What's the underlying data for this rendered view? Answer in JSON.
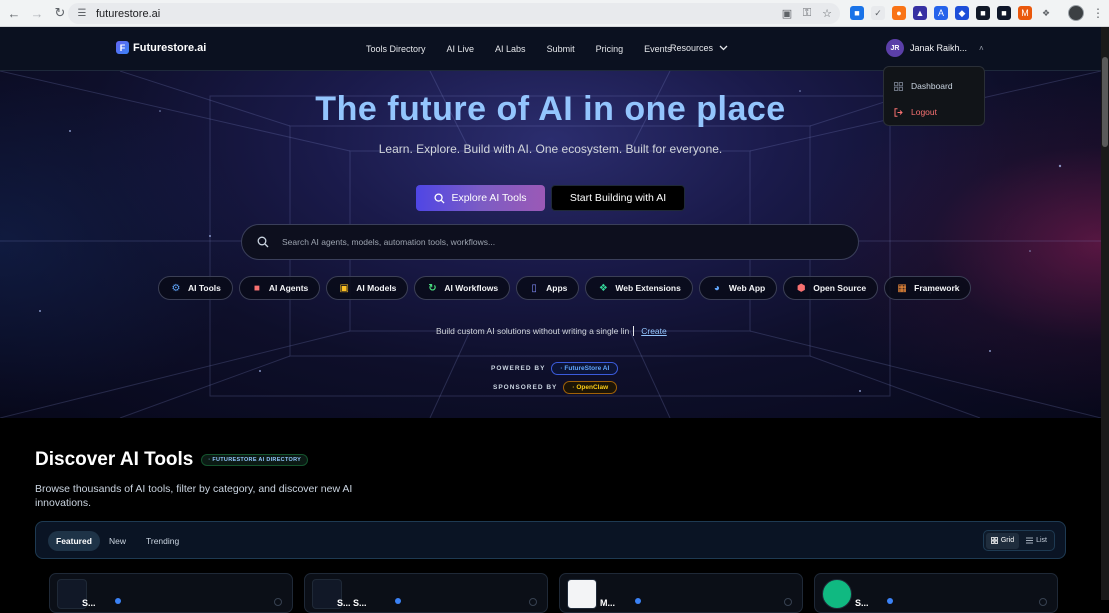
{
  "browser": {
    "url": "futurestore.ai",
    "back_icon": "arrow-left-icon",
    "forward_icon": "arrow-right-icon",
    "reload_icon": "reload-icon"
  },
  "nav": {
    "logo": "Futurestore.ai",
    "logo_mark": "F",
    "links": [
      "Tools Directory",
      "AI Live",
      "AI Labs",
      "Submit",
      "Pricing",
      "Events"
    ],
    "resources": "Resources",
    "user_initials": "JR",
    "user_name": "Janak Raikh..."
  },
  "dropdown": {
    "dashboard": "Dashboard",
    "logout": "Logout"
  },
  "hero": {
    "title": "The future of AI in one place",
    "subtitle": "Learn. Explore. Build with AI. One ecosystem. Built for everyone.",
    "explore_btn": "Explore AI Tools",
    "build_btn": "Start Building with AI",
    "search_placeholder": "Search AI agents, models, automation tools, workflows...",
    "chips": [
      {
        "label": "AI Tools",
        "icon": "gear-icon",
        "color": "#60a5fa"
      },
      {
        "label": "AI Agents",
        "icon": "robot-icon",
        "color": "#f87171"
      },
      {
        "label": "AI Models",
        "icon": "folder-icon",
        "color": "#fbbf24"
      },
      {
        "label": "AI Workflows",
        "icon": "refresh-icon",
        "color": "#4ade80"
      },
      {
        "label": "Apps",
        "icon": "phone-icon",
        "color": "#818cf8"
      },
      {
        "label": "Web Extensions",
        "icon": "puzzle-icon",
        "color": "#34d399"
      },
      {
        "label": "Web App",
        "icon": "globe-icon",
        "color": "#60a5fa"
      },
      {
        "label": "Open Source",
        "icon": "cube-icon",
        "color": "#f87171"
      },
      {
        "label": "Framework",
        "icon": "frame-icon",
        "color": "#fb923c"
      }
    ],
    "custom_text": "Build custom AI solutions without writing a single lin",
    "custom_link": "Create",
    "powered_by_label": "POWERED BY",
    "powered_by_value": "· FutureStore AI",
    "sponsored_by_label": "SPONSORED BY",
    "sponsored_by_value": "· OpenClaw"
  },
  "discover": {
    "title": "Discover AI Tools",
    "badge": "· FUTURESTORE AI DIRECTORY",
    "subtitle": "Browse thousands of AI tools, filter by category, and discover new AI innovations.",
    "tabs": [
      "Featured",
      "New",
      "Trending"
    ],
    "view_grid": "Grid",
    "view_list": "List"
  },
  "cards": [
    {
      "name": "S..."
    },
    {
      "name": "S... S..."
    },
    {
      "name": "M..."
    },
    {
      "name": "S..."
    }
  ]
}
